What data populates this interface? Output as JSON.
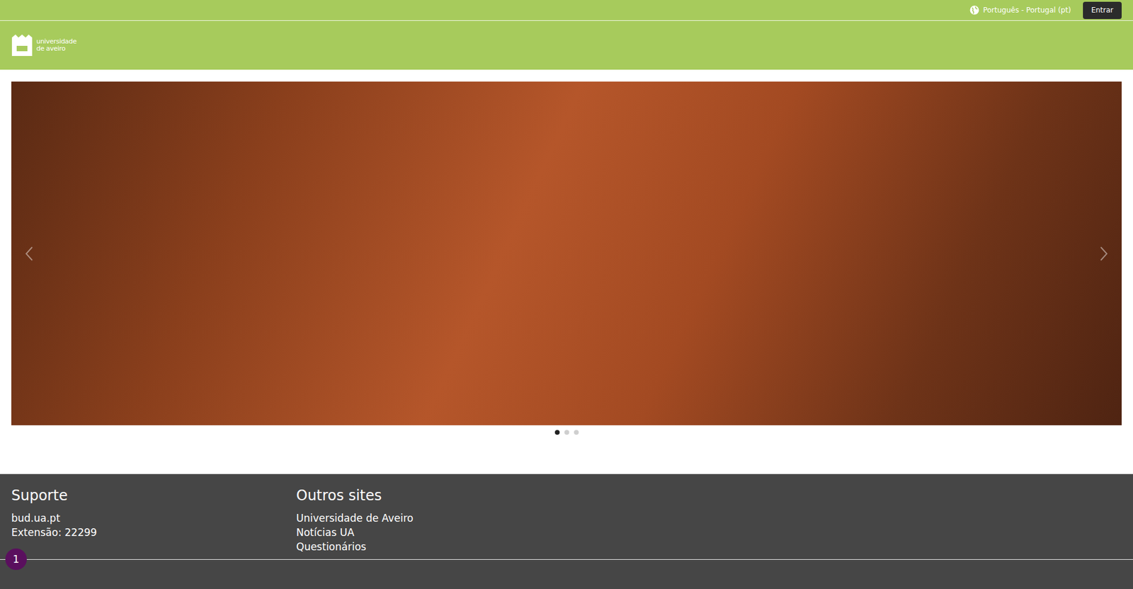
{
  "topbar": {
    "language": "Português - Portugal (pt)",
    "login_button": "Entrar"
  },
  "logo": {
    "lines": [
      "universidade",
      "de aveiro"
    ]
  },
  "carousel": {
    "slides": [
      {
        "selected": true
      },
      {
        "selected": false
      },
      {
        "selected": false
      }
    ]
  },
  "footer": {
    "columns": [
      {
        "title": "Suporte",
        "links": [
          "bud.ua.pt",
          "Extensão: 22299"
        ]
      },
      {
        "title": "Outros sites",
        "links": [
          "Universidade de Aveiro",
          "Notícias UA",
          "Questionários"
        ]
      }
    ]
  },
  "badge": {
    "count": "1"
  }
}
